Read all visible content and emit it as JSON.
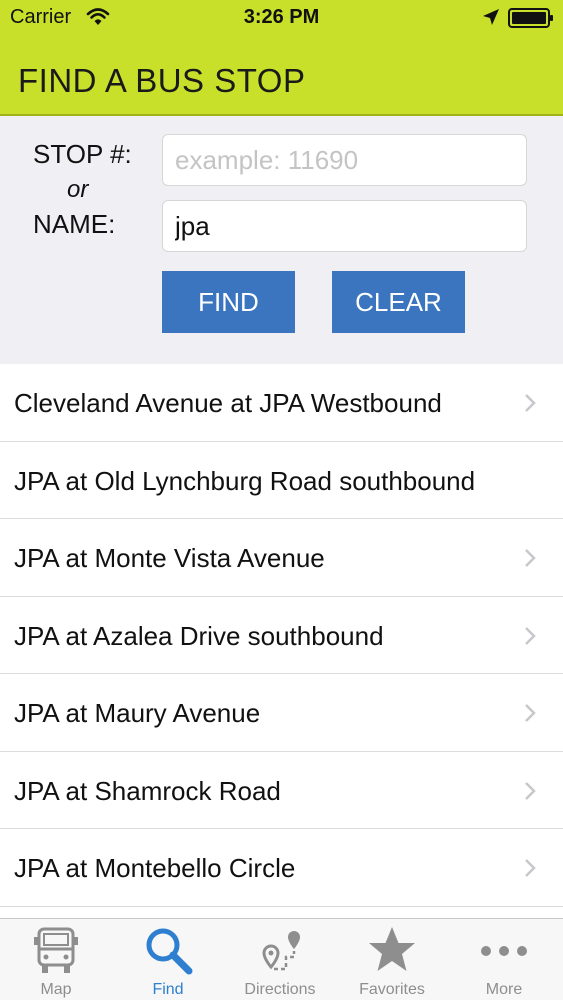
{
  "status": {
    "carrier": "Carrier",
    "time": "3:26 PM"
  },
  "header": {
    "title": "FIND A BUS STOP"
  },
  "search": {
    "stop_label": "STOP #:",
    "or_label": "or",
    "name_label": "NAME:",
    "stop_placeholder": "example: 11690",
    "stop_value": "",
    "name_value": "jpa",
    "find_label": "FIND",
    "clear_label": "CLEAR"
  },
  "results": [
    "Cleveland Avenue at JPA Westbound",
    "JPA at Old Lynchburg Road southbound",
    "JPA at Monte Vista Avenue",
    "JPA at Azalea Drive southbound",
    "JPA at Maury Avenue",
    "JPA at Shamrock Road",
    "JPA at Montebello Circle"
  ],
  "tabs": [
    {
      "label": "Map",
      "icon": "bus-icon"
    },
    {
      "label": "Find",
      "icon": "magnifier-icon",
      "active": true
    },
    {
      "label": "Directions",
      "icon": "route-icon"
    },
    {
      "label": "Favorites",
      "icon": "star-icon"
    },
    {
      "label": "More",
      "icon": "more-dots-icon"
    }
  ],
  "colors": {
    "header": "#c8e02a",
    "button": "#3b75bf",
    "active_tab": "#2f7fd0",
    "inactive_tab": "#8e8e8e"
  }
}
